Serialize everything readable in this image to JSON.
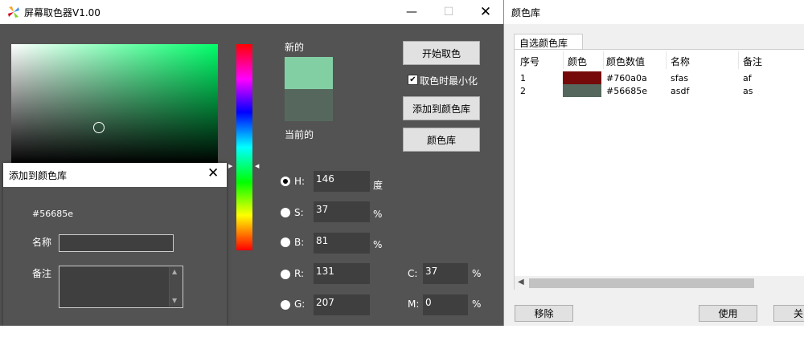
{
  "picker": {
    "title": "屏幕取色器V1.00",
    "minimize_glyph": "—",
    "maximize_glyph": "☐",
    "close_glyph": "✕",
    "new_label": "新的",
    "current_label": "当前的",
    "new_color": "#82cfa4",
    "current_color": "#56685e",
    "start_pick": "开始取色",
    "minimize_on_pick": "取色时最小化",
    "minimize_checked": "✔",
    "add_to_library": "添加到颜色库",
    "library": "颜色库",
    "channels": {
      "h": {
        "label": "H:",
        "value": "146",
        "unit": "度"
      },
      "s": {
        "label": "S:",
        "value": "37",
        "unit": "%"
      },
      "b": {
        "label": "B:",
        "value": "81",
        "unit": "%"
      },
      "r": {
        "label": "R:",
        "value": "131"
      },
      "g": {
        "label": "G:",
        "value": "207"
      },
      "c": {
        "label": "C:",
        "value": "37",
        "unit": "%"
      },
      "m": {
        "label": "M:",
        "value": "0",
        "unit": "%"
      }
    }
  },
  "add_dialog": {
    "title": "添加到颜色库",
    "hex": "#56685e",
    "name_label": "名称",
    "note_label": "备注",
    "name_value": "",
    "note_value": ""
  },
  "library": {
    "title": "颜色库",
    "tab": "自选颜色库",
    "columns": [
      "序号",
      "颜色",
      "颜色数值",
      "名称",
      "备注"
    ],
    "rows": [
      {
        "index": "1",
        "color": "#760a0a",
        "value": "#760a0a",
        "name": "sfas",
        "note": "af"
      },
      {
        "index": "2",
        "color": "#56685e",
        "value": "#56685e",
        "name": "asdf",
        "note": "as"
      }
    ],
    "remove": "移除",
    "use": "使用",
    "close": "关闭"
  },
  "icons": {
    "app": "pinwheel-logo-icon",
    "scroll_left": "◀",
    "arrow_up": "▲",
    "arrow_down": "▼",
    "hue_left": "▶",
    "hue_right": "◀"
  }
}
